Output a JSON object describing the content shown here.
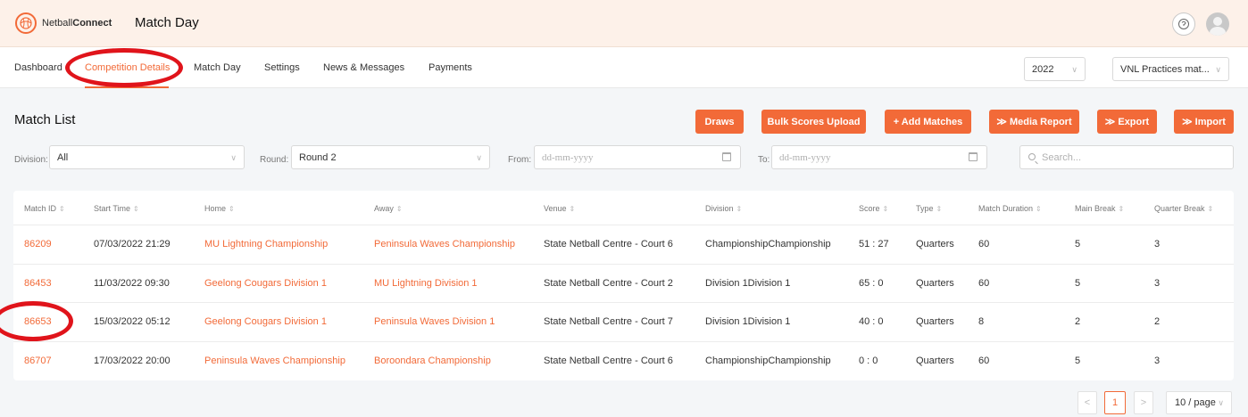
{
  "header": {
    "logo_text_regular": "Netball",
    "logo_text_bold": "Connect",
    "app_title": "Match Day"
  },
  "nav": {
    "items": [
      "Dashboard",
      "Competition Details",
      "Match Day",
      "Settings",
      "News & Messages",
      "Payments"
    ],
    "active": "Competition Details",
    "year": "2022",
    "competition": "VNL Practices mat..."
  },
  "page": {
    "title": "Match List"
  },
  "actions": {
    "draws": "Draws",
    "bulk_scores": "Bulk Scores Upload",
    "add_matches": "+ Add Matches",
    "media_report": "≫ Media Report",
    "export": "≫ Export",
    "import": "≫ Import"
  },
  "filters": {
    "division_label": "Division:",
    "division_value": "All",
    "round_label": "Round:",
    "round_value": "Round 2",
    "from_label": "From:",
    "from_placeholder": "dd-mm-yyyy",
    "to_label": "To:",
    "to_placeholder": "dd-mm-yyyy",
    "search_placeholder": "Search..."
  },
  "table": {
    "columns": [
      "Match ID",
      "Start Time",
      "Home",
      "Away",
      "Venue",
      "Division",
      "Score",
      "Type",
      "Match Duration",
      "Main Break",
      "Quarter Break"
    ],
    "rows": [
      [
        "86209",
        "07/03/2022 21:29",
        "MU Lightning Championship",
        "Peninsula Waves Championship",
        "State Netball Centre - Court 6",
        "ChampionshipChampionship",
        "51 : 27",
        "Quarters",
        "60",
        "5",
        "3"
      ],
      [
        "86453",
        "11/03/2022 09:30",
        "Geelong Cougars Division 1",
        "MU Lightning Division 1",
        "State Netball Centre - Court 2",
        "Division 1Division 1",
        "65 : 0",
        "Quarters",
        "60",
        "5",
        "3"
      ],
      [
        "86653",
        "15/03/2022 05:12",
        "Geelong Cougars Division 1",
        "Peninsula Waves Division 1",
        "State Netball Centre - Court 7",
        "Division 1Division 1",
        "40 : 0",
        "Quarters",
        "8",
        "2",
        "2"
      ],
      [
        "86707",
        "17/03/2022 20:00",
        "Peninsula Waves Championship",
        "Boroondara Championship",
        "State Netball Centre - Court 6",
        "ChampionshipChampionship",
        "0 : 0",
        "Quarters",
        "60",
        "5",
        "3"
      ]
    ]
  },
  "pagination": {
    "prev": "<",
    "current": "1",
    "next": ">",
    "page_size": "10 / page"
  },
  "colors": {
    "accent": "#f26a38",
    "annotation_circle": "#e0141b"
  },
  "icons": [
    "netball-logo-icon",
    "help-icon",
    "avatar",
    "chevron-down-icon",
    "calendar-icon",
    "search-icon",
    "sort-icon"
  ]
}
